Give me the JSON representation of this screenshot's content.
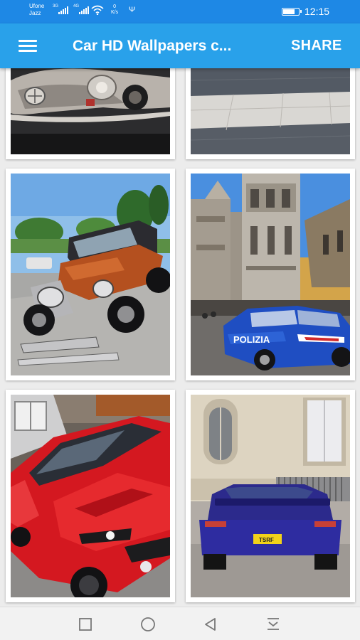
{
  "status_bar": {
    "carrier": "Ufone",
    "carrier2": "Jazz",
    "sig1_tag": "3G",
    "sig2_tag": "4G",
    "speed_value": "0",
    "speed_unit": "K/s",
    "usb_icon": "usb-icon",
    "battery_level": 0.8,
    "time": "12:15"
  },
  "app_bar": {
    "title": "Car HD Wallpapers c...",
    "share_label": "SHARE",
    "menu_icon": "hamburger-menu-icon"
  },
  "wallpapers": [
    {
      "subject": "silver vintage Mercedes car"
    },
    {
      "subject": "stone paved street"
    },
    {
      "subject": "orange vintage car"
    },
    {
      "subject": "Polizia car in Florence"
    },
    {
      "subject": "red Ford Mustang"
    },
    {
      "subject": "blue Nissan Silvia"
    }
  ],
  "nav_bar": {
    "recent_icon": "square-recent-apps-icon",
    "home_icon": "circle-home-icon",
    "back_icon": "triangle-back-icon",
    "notification_icon": "download-arrow-icon"
  }
}
